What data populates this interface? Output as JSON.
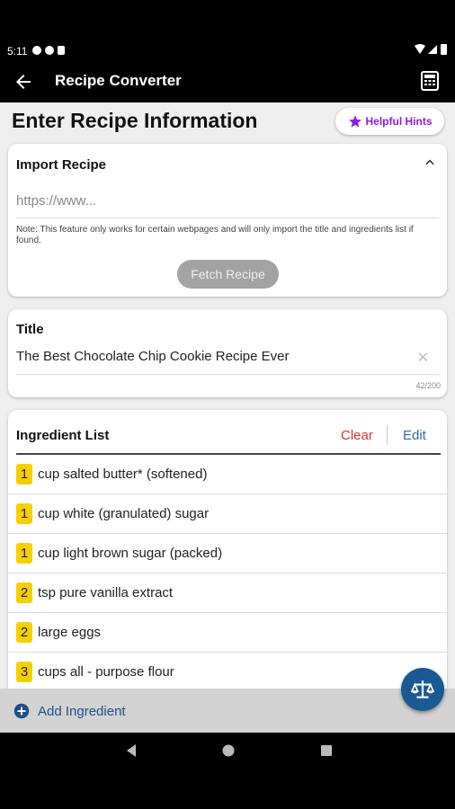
{
  "status_bar": {
    "time": "5:11"
  },
  "app_bar": {
    "title": "Recipe Converter",
    "back_icon": "arrow-left-icon",
    "calc_icon": "calculator-icon"
  },
  "page": {
    "title": "Enter Recipe Information",
    "hints_label": "Helpful Hints",
    "hints_icon": "star-icon",
    "accent": "#8a1ee0"
  },
  "import": {
    "label": "Import Recipe",
    "url_placeholder": "https://www...",
    "note": "Note: This feature only works for certain webpages and will only import the title and ingredients list if found.",
    "fetch_label": "Fetch Recipe"
  },
  "title_card": {
    "label": "Title",
    "value": "The Best Chocolate Chip Cookie Recipe Ever",
    "counter": "42/200"
  },
  "ingredients": {
    "label": "Ingredient List",
    "clear_label": "Clear",
    "edit_label": "Edit",
    "items": [
      {
        "qty": "1",
        "text": "cup salted butter* (softened)"
      },
      {
        "qty": "1",
        "text": "cup white (granulated) sugar"
      },
      {
        "qty": "1",
        "text": "cup light brown sugar (packed)"
      },
      {
        "qty": "2",
        "text": "tsp pure vanilla extract"
      },
      {
        "qty": "2",
        "text": "large eggs"
      },
      {
        "qty": "3",
        "text": "cups all - purpose flour"
      }
    ]
  },
  "add_ingredient_label": "Add Ingredient",
  "fab_icon": "scale-icon"
}
